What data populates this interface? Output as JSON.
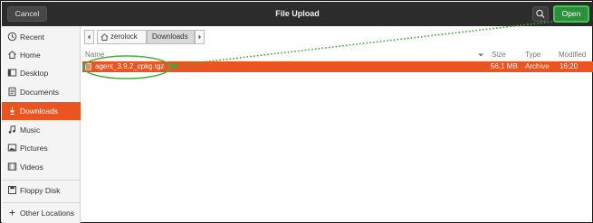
{
  "header": {
    "cancel_label": "Cancel",
    "title": "File Upload",
    "search_icon": "search-icon",
    "open_label": "Open"
  },
  "sidebar": {
    "items": [
      {
        "label": "Recent",
        "icon": "clock-icon"
      },
      {
        "label": "Home",
        "icon": "home-icon"
      },
      {
        "label": "Desktop",
        "icon": "desktop-icon"
      },
      {
        "label": "Documents",
        "icon": "document-icon"
      },
      {
        "label": "Downloads",
        "icon": "download-icon",
        "active": true
      },
      {
        "label": "Music",
        "icon": "music-icon"
      },
      {
        "label": "Pictures",
        "icon": "picture-icon"
      },
      {
        "label": "Videos",
        "icon": "video-icon"
      },
      {
        "label": "Floppy Disk",
        "icon": "floppy-icon"
      },
      {
        "label": "Other Locations",
        "icon": "plus-icon"
      }
    ]
  },
  "pathbar": {
    "crumbs": [
      "zerolock",
      "Downloads"
    ],
    "active_index": 1
  },
  "columns": {
    "name": "Name",
    "size": "Size",
    "type": "Type",
    "modified": "Modified"
  },
  "files": [
    {
      "name": "agent_3.9.2_cpkg.tgz",
      "size": "56.1 MB",
      "type": "Archive",
      "modified": "16:20",
      "selected": true
    }
  ],
  "colors": {
    "accent": "#e95420",
    "header_bg": "#2c2c2c",
    "open_button": "#2b8f3c",
    "annotation": "#4caf3c"
  }
}
